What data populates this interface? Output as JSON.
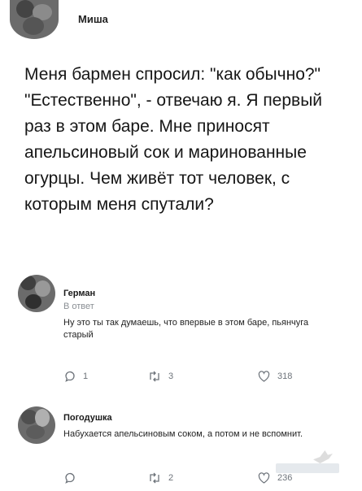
{
  "main_post": {
    "author": "Миша",
    "text": "Меня бармен спросил: \"как обычно?\" \"Естественно\", - отвечаю я. Я первый раз в этом баре. Мне приносят апельсиновый сок и маринованные огурцы. Чем живёт тот человек, с которым меня спутали?"
  },
  "replies": [
    {
      "author": "Герман",
      "context": "В ответ",
      "text": "Ну это ты так думаешь, что впервые в этом баре, пьянчуга старый",
      "counts": {
        "replies": "1",
        "retweets": "3",
        "likes": "318"
      }
    },
    {
      "author": "Погодушка",
      "text": "Набухается апельсиновым соком, а потом и не вспомнит.",
      "counts": {
        "retweets": "2",
        "likes": "236"
      }
    }
  ],
  "icons": {
    "reply": "comment-bubble-icon",
    "retweet": "retweet-arrows-icon",
    "like": "heart-outline-icon"
  },
  "colors": {
    "text_primary": "#161616",
    "text_muted": "#8a8f94",
    "icon_gray": "#6d737a"
  }
}
